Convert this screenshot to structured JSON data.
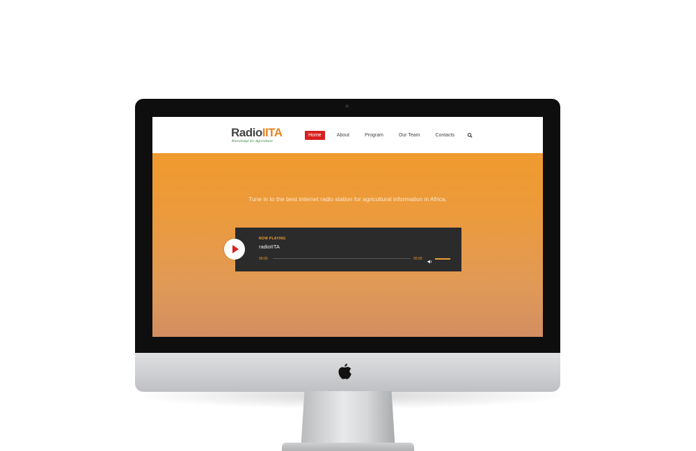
{
  "header": {
    "logo_radio": "Radio",
    "logo_iita": "IITA",
    "logo_tagline": "Knowledge for Agriculture",
    "nav": [
      {
        "label": "Home",
        "active": true
      },
      {
        "label": "About",
        "active": false
      },
      {
        "label": "Program",
        "active": false
      },
      {
        "label": "Our Team",
        "active": false
      },
      {
        "label": "Contacts",
        "active": false
      }
    ],
    "search_icon": "search-icon"
  },
  "hero": {
    "tagline": "Tune in to the best internet radio station for agricultural information in Africa."
  },
  "player": {
    "now_playing_label": "NOW PLAYING",
    "track_title": "radioIITA",
    "current_time": "00:00",
    "duration": "00:00",
    "progress_fraction": 0,
    "volume_fraction": 1.0,
    "play_icon": "play-icon",
    "volume_icon": "volume-icon"
  },
  "colors": {
    "accent": "#d7211f",
    "orange": "#f0a030",
    "player_bg": "#2b2b2b"
  }
}
